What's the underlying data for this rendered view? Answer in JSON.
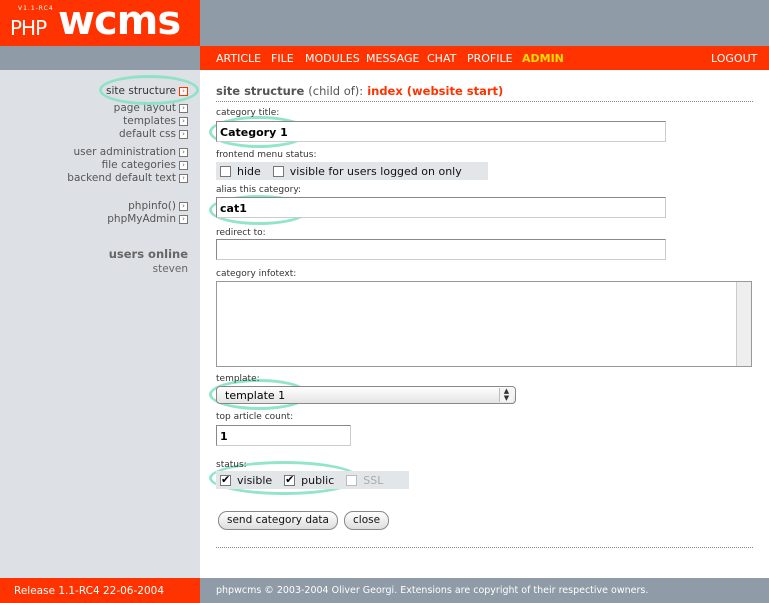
{
  "logo": {
    "version": "V1.1-RC4",
    "php": "PHP",
    "wcms": "wcms"
  },
  "nav": {
    "items": [
      "ARTICLE",
      "FILE",
      "MODULES",
      "MESSAGE",
      "CHAT",
      "PROFILE",
      "ADMIN"
    ],
    "active": "ADMIN",
    "logout": "LOGOUT"
  },
  "sidebar": {
    "items": [
      "site structure",
      "page layout",
      "templates",
      "default css",
      "user administration",
      "file categories",
      "backend default text",
      "phpinfo()",
      "phpMyAdmin"
    ],
    "current": "site structure",
    "users_online_title": "users online",
    "users_online": [
      "steven"
    ]
  },
  "main": {
    "title": "site structure",
    "title_childof": "(child of):",
    "title_parent": "index (website start)",
    "category_title_label": "category title:",
    "category_title_value": "Category 1",
    "menu_status_label": "frontend menu status:",
    "menu_status_hide": "hide",
    "menu_status_loggedon": "visible for users logged on only",
    "alias_label": "alias this category:",
    "alias_value": "cat1",
    "redirect_label": "redirect to:",
    "redirect_value": "",
    "infotext_label": "category infotext:",
    "infotext_value": "",
    "template_label": "template:",
    "template_value": "template 1",
    "top_count_label": "top article count:",
    "top_count_value": "1",
    "status_label": "status:",
    "status_visible": "visible",
    "status_public": "public",
    "status_ssl": "SSL",
    "send_button": "send category data",
    "close_button": "close"
  },
  "footer": {
    "release": "Release 1.1-RC4 22-06-2004",
    "copyright": "phpwcms © 2003-2004 Oliver Georgi. Extensions are copyright of their respective owners."
  },
  "colors": {
    "accent": "#ff3300",
    "header_gray": "#8f9ba6",
    "sidebar_bg": "#dde1e5",
    "highlight_ring": "#86e2c4",
    "active_nav": "#ffdd00"
  }
}
